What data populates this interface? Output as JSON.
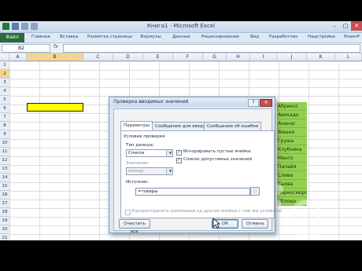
{
  "window": {
    "title": "Книга1 - Microsoft Excel",
    "buttons": {
      "minimize": "–",
      "maximize": "□",
      "close": "✕"
    }
  },
  "ribbon": {
    "file_tab": "Файл",
    "tabs": [
      "Главная",
      "Вставка",
      "Разметка страницы",
      "Формулы",
      "Данные",
      "Рецензирование",
      "Вид",
      "Разработчик",
      "Надстройки",
      "PowerP"
    ]
  },
  "formula_bar": {
    "name_box": "B2",
    "fx": "fx",
    "formula": ""
  },
  "grid": {
    "columns": [
      "A",
      "B",
      "C",
      "D",
      "E",
      "F",
      "G",
      "H",
      "I",
      "J",
      "K",
      "L"
    ],
    "rows": [
      "1",
      "2",
      "3",
      "4",
      "5",
      "6",
      "7",
      "8",
      "9",
      "10",
      "11",
      "12",
      "13",
      "14",
      "15",
      "16",
      "17",
      "18",
      "19",
      "20",
      "21"
    ],
    "selected_cell": "B2",
    "green_list": [
      "Абрикос",
      "Авокадо",
      "Ананас",
      "Вишня",
      "Груша",
      "Клубника",
      "Манго",
      "Папайя",
      "Слива",
      "Тыква",
      "Черносмородина",
      "Яблоки"
    ]
  },
  "dialog": {
    "title": "Проверка вводимых значений",
    "help": "?",
    "close": "✕",
    "tabs": [
      "Параметры",
      "Сообщение для ввода",
      "Сообщение об ошибке"
    ],
    "active_tab": "Параметры",
    "group_label": "Условие проверки",
    "data_type_label": "Тип данных:",
    "data_type_value": "Список",
    "value_label": "Значение:",
    "value_value": "между",
    "ignore_blank_label": "Игнорировать пустые ячейки",
    "ignore_blank_checked": true,
    "dropdown_label": "Список допустимых значений",
    "dropdown_checked": true,
    "source_label": "Источник:",
    "source_value": "=товары",
    "apply_all_label": "Распространить изменения на другие ячейки с тем же условием",
    "apply_all_checked": false,
    "clear_button": "Очистить все",
    "ok_button": "ОК",
    "cancel_button": "Отмена"
  },
  "colors": {
    "highlight_yellow": "#ffff00",
    "list_green": "#92d050",
    "file_tab_green": "#2a6a37"
  }
}
